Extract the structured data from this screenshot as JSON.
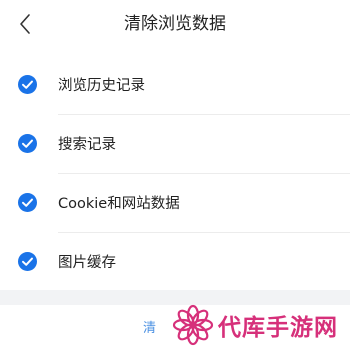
{
  "header": {
    "title": "清除浏览数据",
    "back_icon": "chevron-left-icon"
  },
  "options": [
    {
      "label": "浏览历史记录",
      "checked": true
    },
    {
      "label": "搜索记录",
      "checked": true
    },
    {
      "label": "Cookie和网站数据",
      "checked": true
    },
    {
      "label": "图片缓存",
      "checked": true
    }
  ],
  "confirm": {
    "label": "清"
  },
  "watermark": {
    "text": "代库手游网",
    "logo_icon": "flower-logo-icon"
  },
  "colors": {
    "check": "#1a73e8",
    "watermark": "#d6307a",
    "confirm_text": "#4a90e2"
  }
}
